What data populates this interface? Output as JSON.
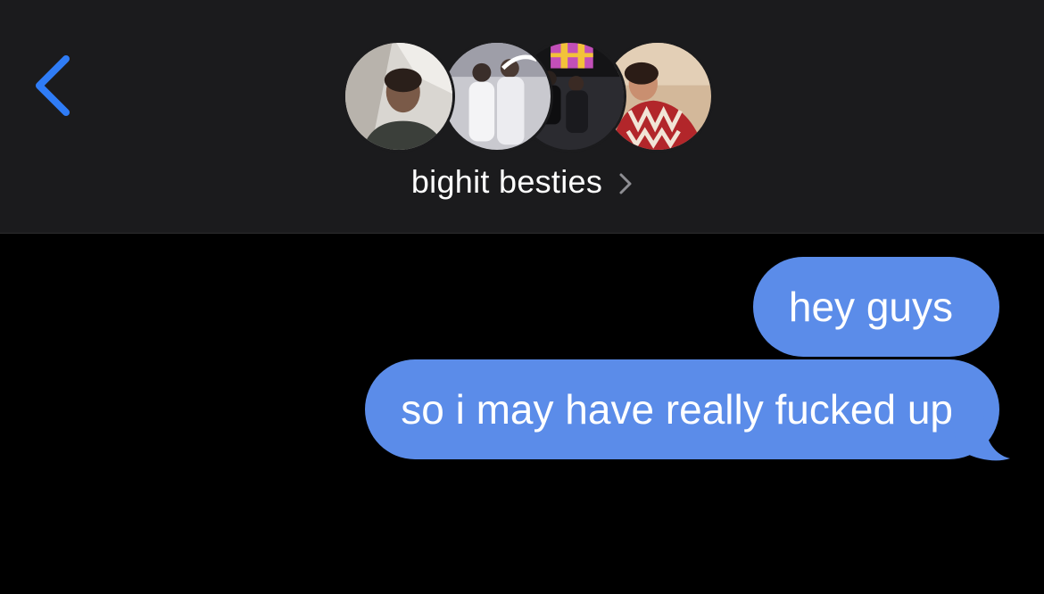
{
  "header": {
    "group_name": "bighit besties",
    "avatars": [
      {
        "name": "avatar-member-1"
      },
      {
        "name": "avatar-member-2"
      },
      {
        "name": "avatar-member-3"
      },
      {
        "name": "avatar-member-4"
      }
    ]
  },
  "messages": [
    {
      "direction": "outgoing",
      "text": "hey guys"
    },
    {
      "direction": "outgoing",
      "text": "so i may have really fucked up"
    }
  ],
  "colors": {
    "accent": "#2f7cf6",
    "bubble": "#5b8ce9",
    "header_bg": "#1b1b1d",
    "background": "#000000"
  },
  "icons": {
    "back": "chevron-left-icon",
    "details": "chevron-right-icon"
  }
}
